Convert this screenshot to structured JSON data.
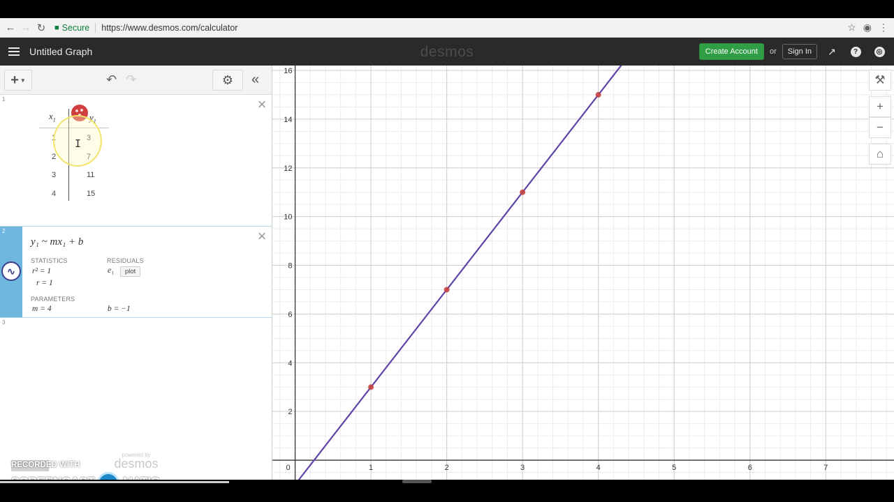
{
  "browser": {
    "secure_label": "Secure",
    "url": "https://www.desmos.com/calculator"
  },
  "header": {
    "title": "Untitled Graph",
    "brand": "desmos",
    "create_account": "Create Account",
    "or": "or",
    "sign_in": "Sign In"
  },
  "expressions": {
    "row_numbers": [
      "1",
      "2",
      "3"
    ],
    "table": {
      "x_header": "x",
      "x_sub": "1",
      "y_header": "y",
      "y_sub": "1",
      "rows": [
        {
          "x": "1",
          "y": "3"
        },
        {
          "x": "2",
          "y": "7"
        },
        {
          "x": "3",
          "y": "11"
        },
        {
          "x": "4",
          "y": "15"
        }
      ]
    },
    "regression": {
      "equation": "y₁ ~ mx₁ + b",
      "statistics_label": "STATISTICS",
      "r2": "r² = 1",
      "r": "r = 1",
      "residuals_label": "RESIDUALS",
      "residual_var": "e₁",
      "plot_label": "plot",
      "parameters_label": "PARAMETERS",
      "m": "m = 4",
      "b": "b = −1"
    }
  },
  "footer": {
    "powered_by": "powered by",
    "brand": "desmos"
  },
  "watermark": {
    "recorded_with": "RECORDED WITH",
    "screencast": "SCREENCAST",
    "matic": "MATIC"
  },
  "colors": {
    "line": "#6043a6",
    "point": "#c74440",
    "secure": "#0b8043",
    "accent_green": "#2f9e44",
    "regression_stripe": "#6fb6df"
  },
  "chart_data": {
    "type": "scatter",
    "grid": true,
    "xlim": [
      -0.3,
      7.9
    ],
    "ylim": [
      -0.8,
      16.2
    ],
    "x_ticks": [
      0,
      1,
      2,
      3,
      4,
      5,
      6,
      7
    ],
    "y_ticks": [
      2,
      4,
      6,
      8,
      10,
      12,
      14,
      16
    ],
    "points": [
      {
        "x": 1,
        "y": 3
      },
      {
        "x": 2,
        "y": 7
      },
      {
        "x": 3,
        "y": 11
      },
      {
        "x": 4,
        "y": 15
      }
    ],
    "line": {
      "slope": 4,
      "intercept": -1
    }
  }
}
